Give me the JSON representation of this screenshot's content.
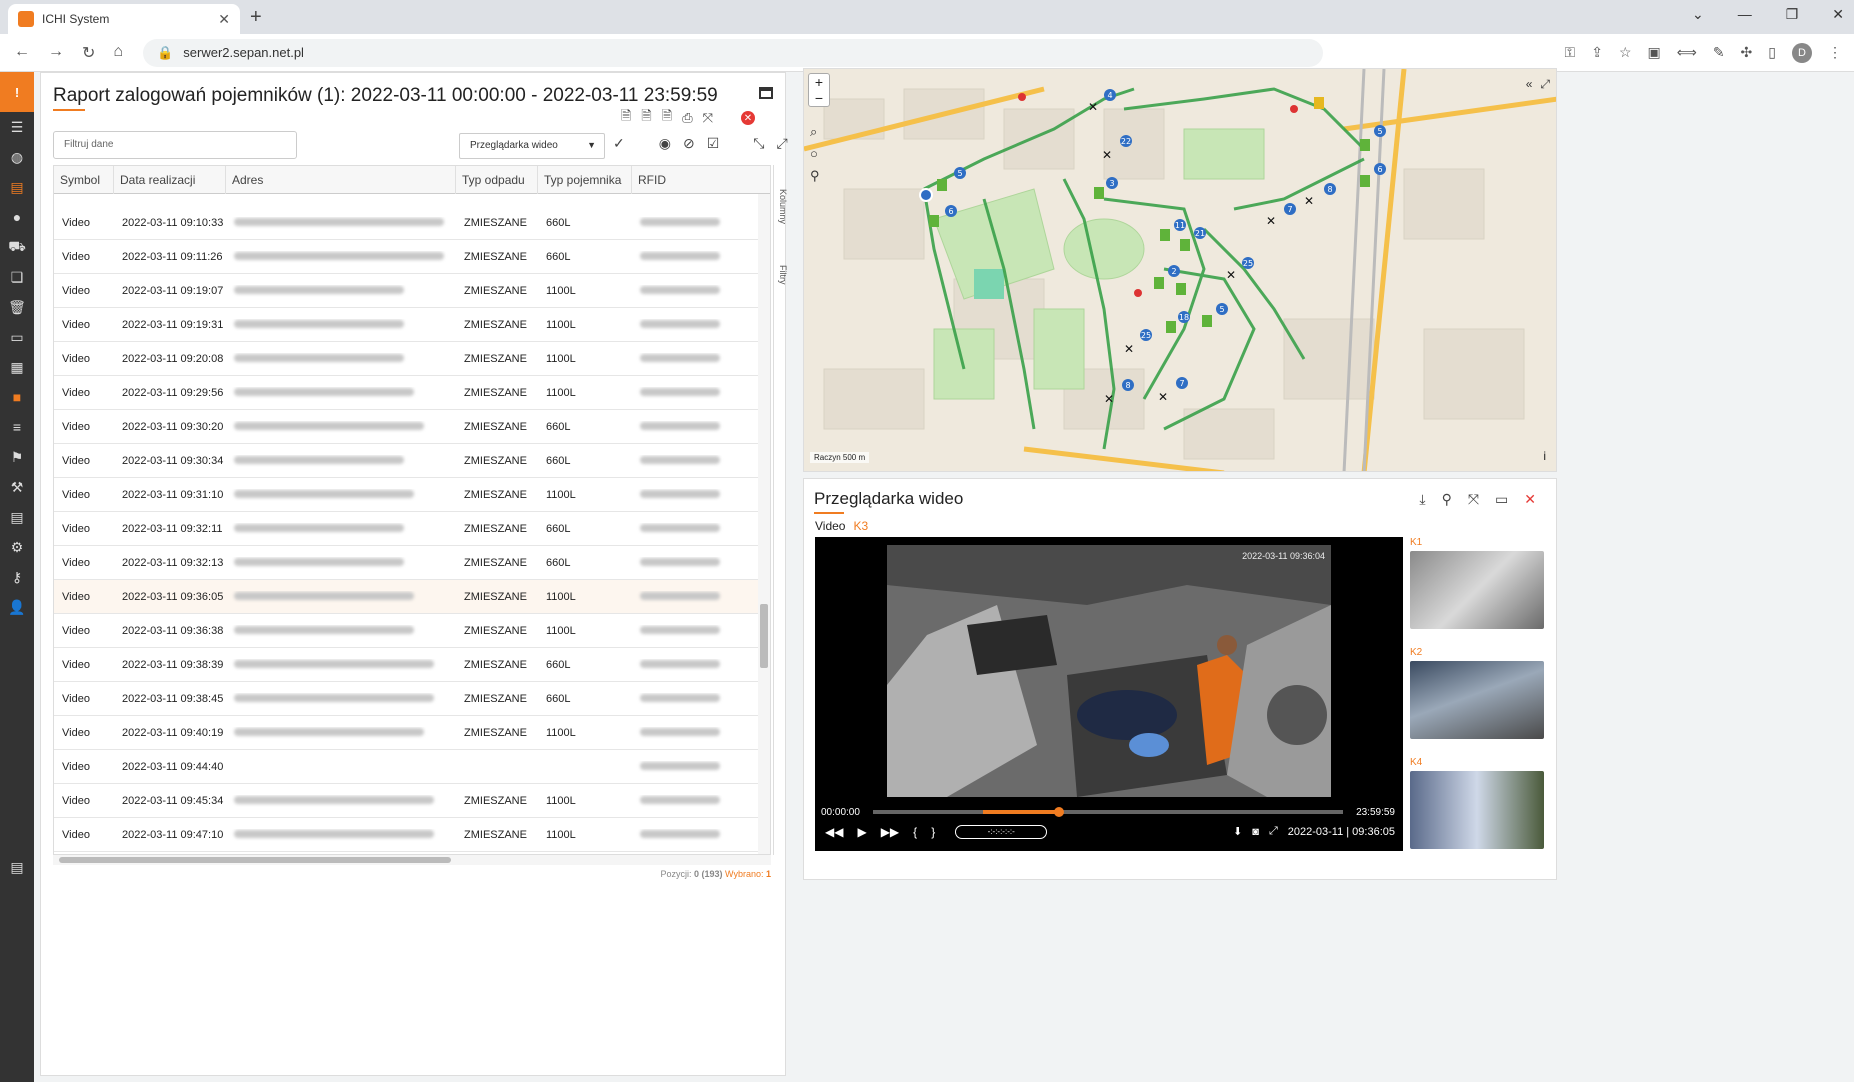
{
  "browser": {
    "tab_title": "ICHI System",
    "url": "serwer2.sepan.net.pl",
    "avatar_letter": "D"
  },
  "report": {
    "title": "Raport zalogowań pojemników (1): 2022-03-11 00:00:00 - 2022-03-11 23:59:59",
    "filter_placeholder": "Filtruj dane",
    "view_select": "Przeglądarka wideo",
    "columns": [
      "Symbol",
      "Data realizacji",
      "Adres",
      "Typ odpadu",
      "Typ pojemnika",
      "RFID"
    ],
    "rows": [
      {
        "symbol": "Video",
        "date": "2022-03-11 09:10:33",
        "waste": "ZMIESZANE",
        "container": "660L"
      },
      {
        "symbol": "Video",
        "date": "2022-03-11 09:11:26",
        "waste": "ZMIESZANE",
        "container": "660L"
      },
      {
        "symbol": "Video",
        "date": "2022-03-11 09:19:07",
        "waste": "ZMIESZANE",
        "container": "1100L"
      },
      {
        "symbol": "Video",
        "date": "2022-03-11 09:19:31",
        "waste": "ZMIESZANE",
        "container": "1100L"
      },
      {
        "symbol": "Video",
        "date": "2022-03-11 09:20:08",
        "waste": "ZMIESZANE",
        "container": "1100L"
      },
      {
        "symbol": "Video",
        "date": "2022-03-11 09:29:56",
        "waste": "ZMIESZANE",
        "container": "1100L"
      },
      {
        "symbol": "Video",
        "date": "2022-03-11 09:30:20",
        "waste": "ZMIESZANE",
        "container": "660L"
      },
      {
        "symbol": "Video",
        "date": "2022-03-11 09:30:34",
        "waste": "ZMIESZANE",
        "container": "660L"
      },
      {
        "symbol": "Video",
        "date": "2022-03-11 09:31:10",
        "waste": "ZMIESZANE",
        "container": "1100L"
      },
      {
        "symbol": "Video",
        "date": "2022-03-11 09:32:11",
        "waste": "ZMIESZANE",
        "container": "660L"
      },
      {
        "symbol": "Video",
        "date": "2022-03-11 09:32:13",
        "waste": "ZMIESZANE",
        "container": "660L"
      },
      {
        "symbol": "Video",
        "date": "2022-03-11 09:36:05",
        "waste": "ZMIESZANE",
        "container": "1100L"
      },
      {
        "symbol": "Video",
        "date": "2022-03-11 09:36:38",
        "waste": "ZMIESZANE",
        "container": "1100L"
      },
      {
        "symbol": "Video",
        "date": "2022-03-11 09:38:39",
        "waste": "ZMIESZANE",
        "container": "660L"
      },
      {
        "symbol": "Video",
        "date": "2022-03-11 09:38:45",
        "waste": "ZMIESZANE",
        "container": "660L"
      },
      {
        "symbol": "Video",
        "date": "2022-03-11 09:40:19",
        "waste": "ZMIESZANE",
        "container": "1100L"
      },
      {
        "symbol": "Video",
        "date": "2022-03-11 09:44:40",
        "waste": "",
        "container": ""
      },
      {
        "symbol": "Video",
        "date": "2022-03-11 09:45:34",
        "waste": "ZMIESZANE",
        "container": "1100L"
      },
      {
        "symbol": "Video",
        "date": "2022-03-11 09:47:10",
        "waste": "ZMIESZANE",
        "container": "1100L"
      }
    ],
    "side_tabs": [
      "Kolumny",
      "Filtry"
    ],
    "status_positions_label": "Pozycji:",
    "status_positions_value": "0 (193)",
    "status_selected_label": "Wybrano:",
    "status_selected_value": "1"
  },
  "map": {
    "scale_label": "Raczyn 500 m",
    "marker_numbers": [
      "4",
      "5",
      "6",
      "3",
      "22",
      "5",
      "6",
      "8",
      "7",
      "11",
      "21",
      "2",
      "25",
      "18",
      "5",
      "25",
      "8",
      "7",
      "1"
    ]
  },
  "video": {
    "title": "Przeglądarka wideo",
    "label": "Video",
    "camera": "K3",
    "timestamp_overlay": "2022-03-11 09:36:04",
    "time_start": "00:00:00",
    "time_end": "23:59:59",
    "speed_text": "-:-:-:-:-:-",
    "current": "2022-03-11 | 09:36:05",
    "progress_fraction": 0.395,
    "thumbnails": [
      "K1",
      "K2",
      "K4"
    ]
  }
}
